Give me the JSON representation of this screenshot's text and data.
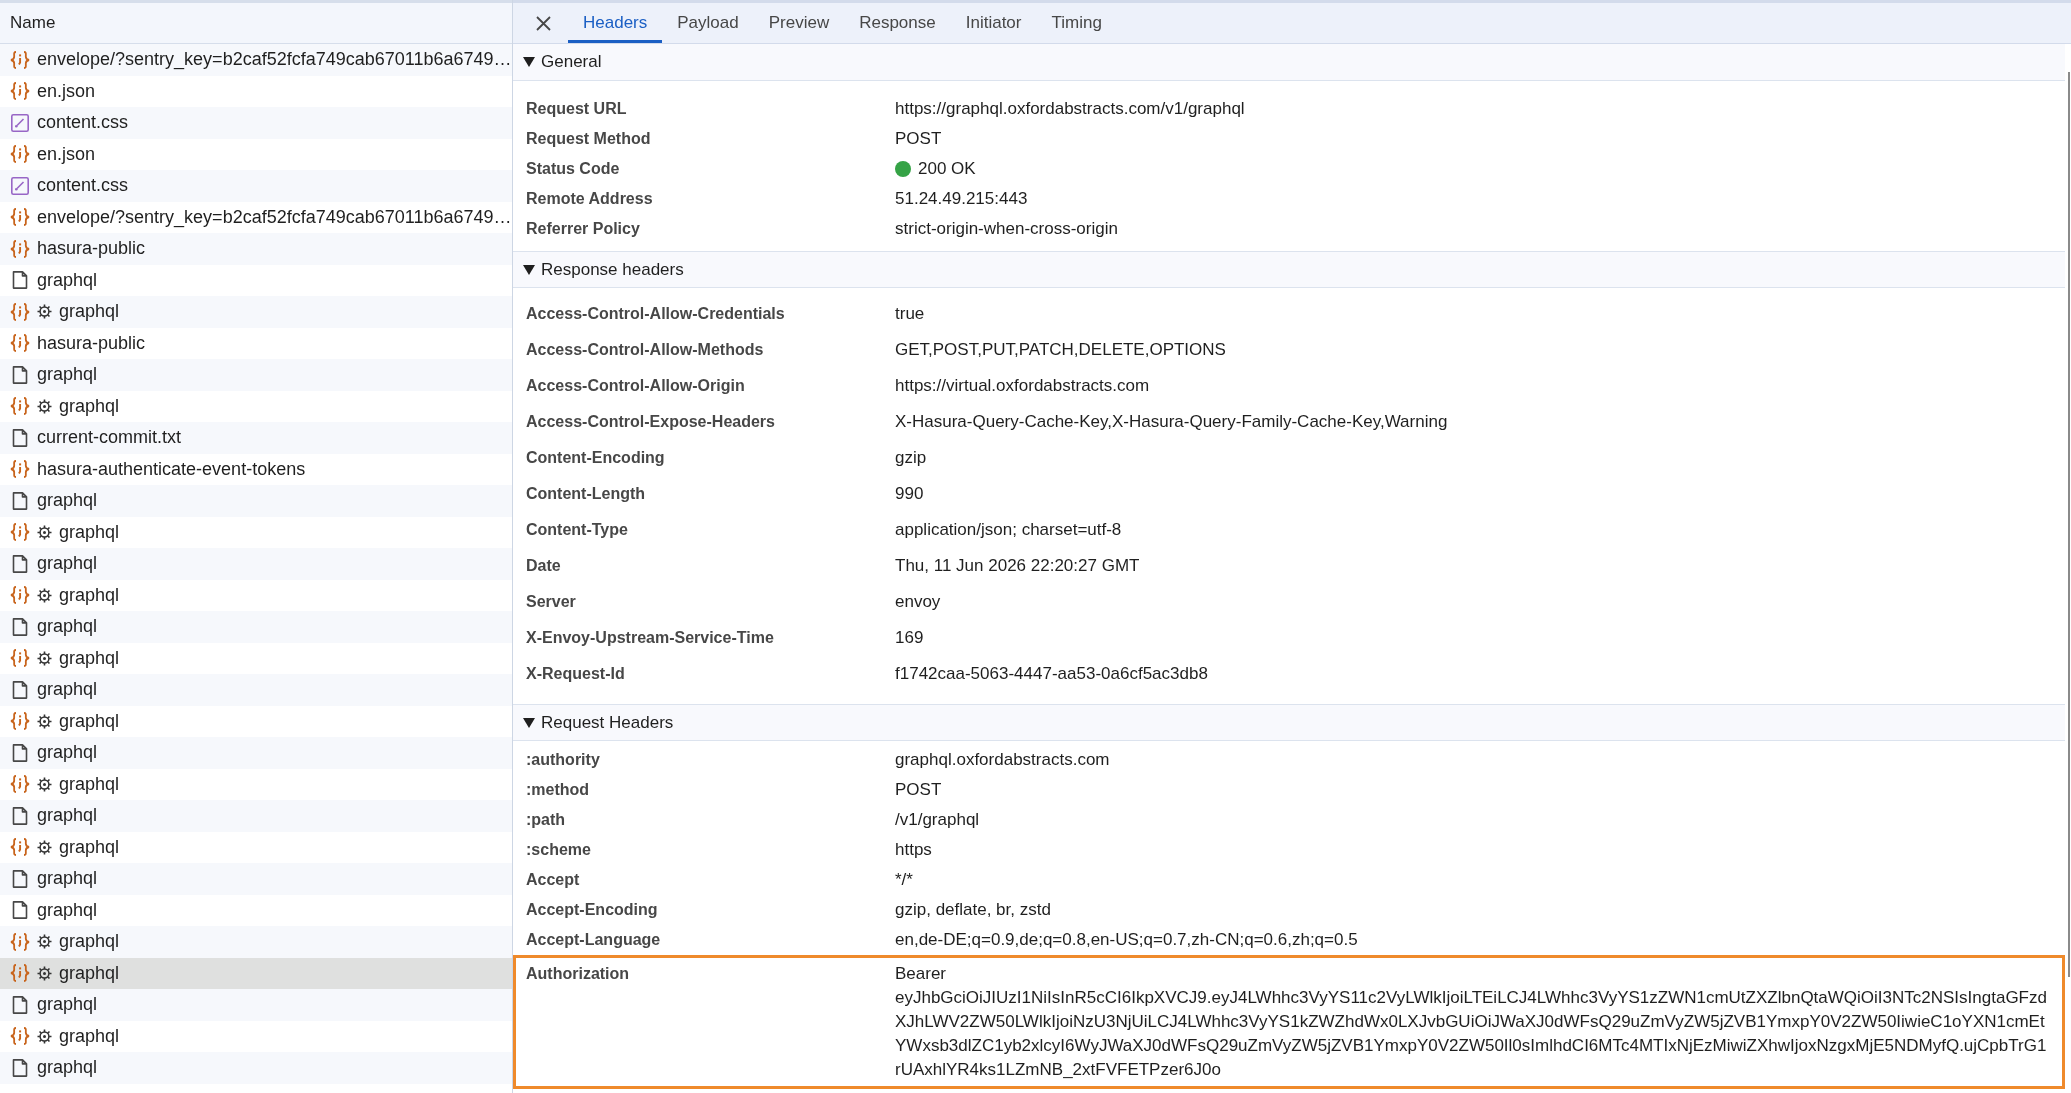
{
  "request_list": {
    "column": "Name",
    "requests": [
      {
        "name": "envelope/?sentry_key=b2caf52fcfa749cab67011b6a6749…",
        "kind": "json",
        "gear": false,
        "selected": false
      },
      {
        "name": "en.json",
        "kind": "json",
        "gear": false,
        "selected": false
      },
      {
        "name": "content.css",
        "kind": "css",
        "gear": false,
        "selected": false
      },
      {
        "name": "en.json",
        "kind": "json",
        "gear": false,
        "selected": false
      },
      {
        "name": "content.css",
        "kind": "css",
        "gear": false,
        "selected": false
      },
      {
        "name": "envelope/?sentry_key=b2caf52fcfa749cab67011b6a6749…",
        "kind": "json",
        "gear": false,
        "selected": false
      },
      {
        "name": "hasura-public",
        "kind": "json",
        "gear": false,
        "selected": false
      },
      {
        "name": "graphql",
        "kind": "document",
        "gear": false,
        "selected": false
      },
      {
        "name": "graphql",
        "kind": "json",
        "gear": true,
        "selected": false
      },
      {
        "name": "hasura-public",
        "kind": "json",
        "gear": false,
        "selected": false
      },
      {
        "name": "graphql",
        "kind": "document",
        "gear": false,
        "selected": false
      },
      {
        "name": "graphql",
        "kind": "json",
        "gear": true,
        "selected": false
      },
      {
        "name": "current-commit.txt",
        "kind": "document",
        "gear": false,
        "selected": false
      },
      {
        "name": "hasura-authenticate-event-tokens",
        "kind": "json",
        "gear": false,
        "selected": false
      },
      {
        "name": "graphql",
        "kind": "document",
        "gear": false,
        "selected": false
      },
      {
        "name": "graphql",
        "kind": "json",
        "gear": true,
        "selected": false
      },
      {
        "name": "graphql",
        "kind": "document",
        "gear": false,
        "selected": false
      },
      {
        "name": "graphql",
        "kind": "json",
        "gear": true,
        "selected": false
      },
      {
        "name": "graphql",
        "kind": "document",
        "gear": false,
        "selected": false
      },
      {
        "name": "graphql",
        "kind": "json",
        "gear": true,
        "selected": false
      },
      {
        "name": "graphql",
        "kind": "document",
        "gear": false,
        "selected": false
      },
      {
        "name": "graphql",
        "kind": "json",
        "gear": true,
        "selected": false
      },
      {
        "name": "graphql",
        "kind": "document",
        "gear": false,
        "selected": false
      },
      {
        "name": "graphql",
        "kind": "json",
        "gear": true,
        "selected": false
      },
      {
        "name": "graphql",
        "kind": "document",
        "gear": false,
        "selected": false
      },
      {
        "name": "graphql",
        "kind": "json",
        "gear": true,
        "selected": false
      },
      {
        "name": "graphql",
        "kind": "document",
        "gear": false,
        "selected": false
      },
      {
        "name": "graphql",
        "kind": "document",
        "gear": false,
        "selected": false
      },
      {
        "name": "graphql",
        "kind": "json",
        "gear": true,
        "selected": false
      },
      {
        "name": "graphql",
        "kind": "json",
        "gear": true,
        "selected": true
      },
      {
        "name": "graphql",
        "kind": "document",
        "gear": false,
        "selected": false
      },
      {
        "name": "graphql",
        "kind": "json",
        "gear": true,
        "selected": false
      },
      {
        "name": "graphql",
        "kind": "document",
        "gear": false,
        "selected": false
      }
    ]
  },
  "detail": {
    "tabs": [
      {
        "label": "Headers",
        "selected": true
      },
      {
        "label": "Payload",
        "selected": false
      },
      {
        "label": "Preview",
        "selected": false
      },
      {
        "label": "Response",
        "selected": false
      },
      {
        "label": "Initiator",
        "selected": false
      },
      {
        "label": "Timing",
        "selected": false
      }
    ],
    "sections": [
      {
        "title": "General",
        "kind": "general",
        "expanded": true,
        "rows": [
          {
            "name": "Request URL",
            "value": "https://graphql.oxfordabstracts.com/v1/graphql",
            "kind": "text"
          },
          {
            "name": "Request Method",
            "value": "POST",
            "kind": "text"
          },
          {
            "name": "Status Code",
            "value": "200 OK",
            "kind": "status"
          },
          {
            "name": "Remote Address",
            "value": "51.24.49.215:443",
            "kind": "text"
          },
          {
            "name": "Referrer Policy",
            "value": "strict-origin-when-cross-origin",
            "kind": "text"
          }
        ]
      },
      {
        "title": "Response headers",
        "kind": "response_headers",
        "expanded": true,
        "rows": [
          {
            "name": "Access-Control-Allow-Credentials",
            "value": "true"
          },
          {
            "name": "Access-Control-Allow-Methods",
            "value": "GET,POST,PUT,PATCH,DELETE,OPTIONS"
          },
          {
            "name": "Access-Control-Allow-Origin",
            "value": "https://virtual.oxfordabstracts.com"
          },
          {
            "name": "Access-Control-Expose-Headers",
            "value": "X-Hasura-Query-Cache-Key,X-Hasura-Query-Family-Cache-Key,Warning"
          },
          {
            "name": "Content-Encoding",
            "value": "gzip"
          },
          {
            "name": "Content-Length",
            "value": "990"
          },
          {
            "name": "Content-Type",
            "value": "application/json; charset=utf-8"
          },
          {
            "name": "Date",
            "value": "Thu, 11 Jun 2026 22:20:27 GMT"
          },
          {
            "name": "Server",
            "value": "envoy"
          },
          {
            "name": "X-Envoy-Upstream-Service-Time",
            "value": "169"
          },
          {
            "name": "X-Request-Id",
            "value": "f1742caa-5063-4447-aa53-0a6cf5ac3db8"
          }
        ]
      },
      {
        "title": "Request Headers",
        "kind": "request_headers",
        "expanded": true,
        "rows": [
          {
            "name": ":authority",
            "value": "graphql.oxfordabstracts.com",
            "highlighted": false
          },
          {
            "name": ":method",
            "value": "POST",
            "highlighted": false
          },
          {
            "name": ":path",
            "value": "/v1/graphql",
            "highlighted": false
          },
          {
            "name": ":scheme",
            "value": "https",
            "highlighted": false
          },
          {
            "name": "Accept",
            "value": "*/*",
            "highlighted": false
          },
          {
            "name": "Accept-Encoding",
            "value": "gzip, deflate, br, zstd",
            "highlighted": false
          },
          {
            "name": "Accept-Language",
            "value": "en,de-DE;q=0.9,de;q=0.8,en-US;q=0.7,zh-CN;q=0.6,zh;q=0.5",
            "highlighted": false
          },
          {
            "name": "Authorization",
            "value": "Bearer eyJhbGciOiJIUzI1NiIsInR5cCI6IkpXVCJ9.eyJ4LWhhc3VyYS11c2VyLWlkIjoiLTEiLCJ4LWhhc3VyYS1zZWN1cmUtZXZlbnQtaWQiOiI3NTc2NSIsIngtaGFzdXJhLWV2ZW50LWlkIjoiNzU3NjUiLCJ4LWhhc3VyYS1kZWZhdWx0LXJvbGUiOiJWaXJ0dWFsQ29uZmVyZW5jZVB1YmxpY0V2ZW50IiwieC1oYXN1cmEtYWxsb3dlZC1yb2xlcyI6WyJWaXJ0dWFsQ29uZmVyZW5jZVB1YmxpY0V2ZW50Il0sImlhdCI6MTc4MTIxNjEzMiwiZXhwIjoxNzgxMjE5NDMyfQ.ujCpbTrG1rUAxhlYR4ks1LZmNB_2xtFVFETPzer6J0o",
            "highlighted": true
          }
        ]
      }
    ]
  }
}
